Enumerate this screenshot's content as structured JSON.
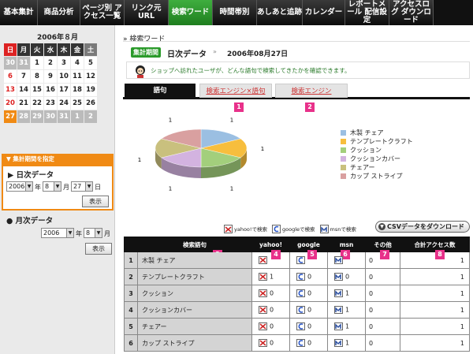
{
  "nav": {
    "tabs": [
      {
        "label": "基本集計",
        "active": false
      },
      {
        "label": "商品分析",
        "active": false
      },
      {
        "label": "ページ別 アクセス一覧",
        "active": false
      },
      {
        "label": "リンク元URL",
        "active": false
      },
      {
        "label": "検索ワード",
        "active": true
      },
      {
        "label": "時間帯別",
        "active": false
      },
      {
        "label": "あしあと追跡",
        "active": false
      },
      {
        "label": "カレンダー",
        "active": false
      },
      {
        "label": "レポートメール 配信設定",
        "active": false
      },
      {
        "label": "アクセスログ ダウンロード",
        "active": false
      }
    ]
  },
  "sidebar": {
    "calendar_title": "2006年８月",
    "weekdays": [
      "日",
      "月",
      "火",
      "水",
      "木",
      "金",
      "土"
    ],
    "weeks": [
      [
        {
          "d": "30",
          "s": "o"
        },
        {
          "d": "31",
          "s": "o"
        },
        {
          "d": "1",
          "s": "n"
        },
        {
          "d": "2",
          "s": "n"
        },
        {
          "d": "3",
          "s": "n"
        },
        {
          "d": "4",
          "s": "n"
        },
        {
          "d": "5",
          "s": "n"
        }
      ],
      [
        {
          "d": "6",
          "s": "n"
        },
        {
          "d": "7",
          "s": "n"
        },
        {
          "d": "8",
          "s": "n"
        },
        {
          "d": "9",
          "s": "n"
        },
        {
          "d": "10",
          "s": "n"
        },
        {
          "d": "11",
          "s": "n"
        },
        {
          "d": "12",
          "s": "n"
        }
      ],
      [
        {
          "d": "13",
          "s": "n"
        },
        {
          "d": "14",
          "s": "n"
        },
        {
          "d": "15",
          "s": "n"
        },
        {
          "d": "16",
          "s": "n"
        },
        {
          "d": "17",
          "s": "n"
        },
        {
          "d": "18",
          "s": "n"
        },
        {
          "d": "19",
          "s": "n"
        }
      ],
      [
        {
          "d": "20",
          "s": "n"
        },
        {
          "d": "21",
          "s": "n"
        },
        {
          "d": "22",
          "s": "n"
        },
        {
          "d": "23",
          "s": "n"
        },
        {
          "d": "24",
          "s": "n"
        },
        {
          "d": "25",
          "s": "n"
        },
        {
          "d": "26",
          "s": "n"
        }
      ],
      [
        {
          "d": "27",
          "s": "sel"
        },
        {
          "d": "28",
          "s": "o"
        },
        {
          "d": "29",
          "s": "o"
        },
        {
          "d": "30",
          "s": "o"
        },
        {
          "d": "31",
          "s": "o"
        },
        {
          "d": "1",
          "s": "o"
        },
        {
          "d": "2",
          "s": "o"
        }
      ]
    ],
    "period_label": "▼ 集計期間を指定",
    "daily": {
      "title": "▶ 日次データ",
      "year": "2006",
      "year_unit": "年",
      "month": "8",
      "month_unit": "月",
      "day": "27",
      "day_unit": "日",
      "button": "表示"
    },
    "monthly": {
      "title": "● 月次データ",
      "year": "2006",
      "year_unit": "年",
      "month": "8",
      "month_unit": "月",
      "button": "表示"
    }
  },
  "main": {
    "breadcrumb": "» 検索ワード",
    "period_badge": "集計期間",
    "period_type": "日次データ",
    "period_sep": "»",
    "period_date": "2006年08月27日",
    "description": "ショップへ訪れたユーザが、どんな語句で検索してきたかを確認できます。",
    "tabs": [
      {
        "label": "語句",
        "active": true
      },
      {
        "label": "検索エンジン×語句",
        "active": false
      },
      {
        "label": "検索エンジン",
        "active": false
      }
    ],
    "badges": {
      "b1": "1",
      "b2": "2",
      "b3": "3",
      "b4": "4",
      "b5": "5",
      "b6": "6",
      "b7": "7",
      "b8": "8"
    },
    "engine_legend": {
      "yahoo": "yahoo!で検索",
      "google": "googleで検索",
      "msn": "msnで検索"
    },
    "csv_button": "CSVデータをダウンロード",
    "table": {
      "headers": [
        "検索語句",
        "yahoo!",
        "google",
        "msn",
        "その他",
        "合計アクセス数"
      ],
      "rows": [
        {
          "n": "1",
          "kw": "木製 チェア",
          "yahoo": "",
          "google": "",
          "msn": "",
          "other": "0",
          "total": "1"
        },
        {
          "n": "2",
          "kw": "テンプレートクラフト",
          "yahoo": "1",
          "google": "0",
          "msn": "0",
          "other": "0",
          "total": "1"
        },
        {
          "n": "3",
          "kw": "クッション",
          "yahoo": "0",
          "google": "0",
          "msn": "1",
          "other": "0",
          "total": "1"
        },
        {
          "n": "4",
          "kw": "クッションカバー",
          "yahoo": "0",
          "google": "0",
          "msn": "1",
          "other": "0",
          "total": "1"
        },
        {
          "n": "5",
          "kw": "チェアー",
          "yahoo": "0",
          "google": "0",
          "msn": "1",
          "other": "0",
          "total": "1"
        },
        {
          "n": "6",
          "kw": "カップ ストライプ",
          "yahoo": "0",
          "google": "0",
          "msn": "1",
          "other": "0",
          "total": "1"
        }
      ]
    }
  },
  "chart_data": {
    "type": "pie",
    "categories": [
      "木製 チェア",
      "テンプレートクラフト",
      "クッション",
      "クッションカバー",
      "チェアー",
      "カップ ストライプ"
    ],
    "values": [
      1,
      1,
      1,
      1,
      1,
      1
    ],
    "data_labels": [
      "1",
      "1",
      "1",
      "1",
      "1",
      "1"
    ],
    "colors": [
      "#9bbfe2",
      "#f7be3d",
      "#a3cf7c",
      "#d3b3e0",
      "#c9c07e",
      "#d9a0a0"
    ],
    "legend_placement": "right"
  },
  "colors": {
    "accent_orange": "#f08a14",
    "active_green": "#2a9a2a",
    "badge_pink": "#e8318a"
  }
}
